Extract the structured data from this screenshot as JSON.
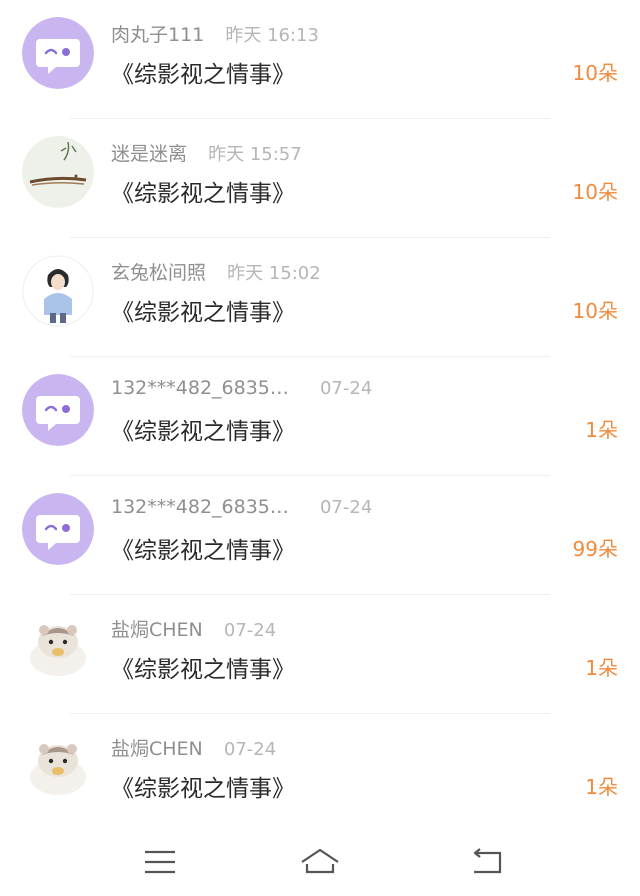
{
  "rows": [
    {
      "user": "肉丸子111",
      "time": "昨天 16:13",
      "title": "《综影视之情事》",
      "gift": "10朵",
      "avatar": "default"
    },
    {
      "user": "迷是迷离",
      "time": "昨天 15:57",
      "title": "《综影视之情事》",
      "gift": "10朵",
      "avatar": "drawing"
    },
    {
      "user": "玄兔松间照",
      "time": "昨天 15:02",
      "title": "《综影视之情事》",
      "gift": "10朵",
      "avatar": "person"
    },
    {
      "user": "132***482_6835…",
      "time": "07-24",
      "title": "《综影视之情事》",
      "gift": "1朵",
      "avatar": "default"
    },
    {
      "user": "132***482_6835…",
      "time": "07-24",
      "title": "《综影视之情事》",
      "gift": "99朵",
      "avatar": "default"
    },
    {
      "user": "盐焗CHEN",
      "time": "07-24",
      "title": "《综影视之情事》",
      "gift": "1朵",
      "avatar": "hamster"
    },
    {
      "user": "盐焗CHEN",
      "time": "07-24",
      "title": "《综影视之情事》",
      "gift": "1朵",
      "avatar": "hamster"
    }
  ],
  "colors": {
    "gift": "#f08a3c",
    "avatar_default": "#c9b6f1",
    "user": "#8f8f8f",
    "title": "#2a2a2a"
  },
  "navbar": {
    "menu_icon": "menu-icon",
    "home_icon": "home-icon",
    "back_icon": "back-icon"
  }
}
